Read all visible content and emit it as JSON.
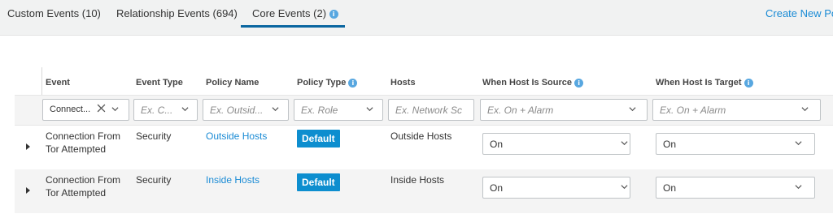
{
  "tabs": [
    {
      "label": "Custom Events (10)"
    },
    {
      "label": "Relationship Events (694)"
    },
    {
      "label": "Core Events (2)"
    }
  ],
  "create_link": "Create New Po",
  "columns": {
    "event": "Event",
    "event_type": "Event Type",
    "policy_name": "Policy Name",
    "policy_type": "Policy Type",
    "hosts": "Hosts",
    "when_source": "When Host Is Source",
    "when_target": "When Host Is Target"
  },
  "filters": {
    "event_value": "Connect...",
    "event_type_ph": "Ex. C...",
    "policy_name_ph": "Ex. Outsid...",
    "policy_type_ph": "Ex. Role",
    "hosts_ph": "Ex. Network Sc",
    "source_ph": "Ex. On + Alarm",
    "target_ph": "Ex. On + Alarm"
  },
  "rows": [
    {
      "event_line1": "Connection From",
      "event_line2": "Tor Attempted",
      "event_type": "Security",
      "policy_name": "Outside Hosts",
      "policy_type": "Default",
      "hosts": "Outside Hosts",
      "source": "On",
      "target": "On"
    },
    {
      "event_line1": "Connection From",
      "event_line2": "Tor Attempted",
      "event_type": "Security",
      "policy_name": "Inside Hosts",
      "policy_type": "Default",
      "hosts": "Inside Hosts",
      "source": "On",
      "target": "On"
    }
  ],
  "icons": {
    "info": "info-icon",
    "chevron": "chevron-down-icon",
    "clear": "clear-x-icon",
    "expander": "caret-right-icon"
  },
  "colors": {
    "accent": "#0a66a0",
    "link": "#1a8bd5",
    "badge": "#0d8ecf",
    "info": "#58a7e0"
  }
}
